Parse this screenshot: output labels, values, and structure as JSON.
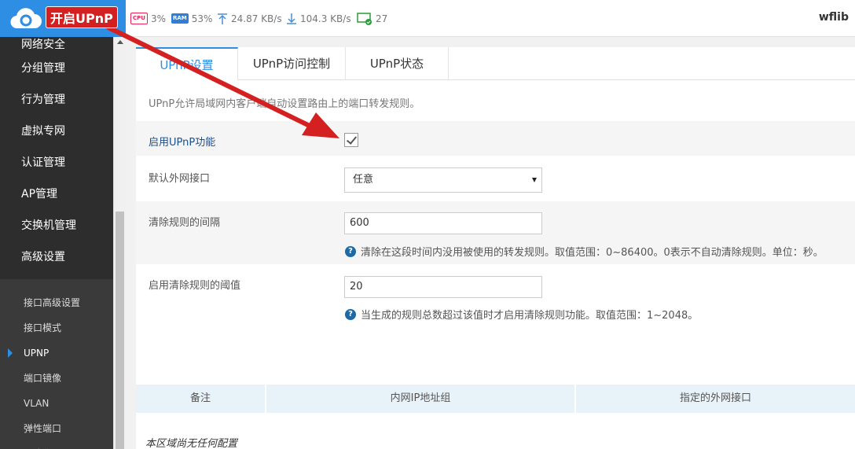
{
  "header": {
    "brand_text": "",
    "cpu_chip": "CPU",
    "cpu_value": "3%",
    "ram_chip": "RAM",
    "ram_value": "53%",
    "upload_value": "24.87 KB/s",
    "download_value": "104.3 KB/s",
    "online_count": "27",
    "username": "wflib",
    "accent_color": "#2d8ee3"
  },
  "sidebar": {
    "main_items": [
      "网络安全",
      "分组管理",
      "行为管理",
      "虚拟专网",
      "认证管理",
      "AP管理",
      "交换机管理",
      "高级设置"
    ],
    "sub_items": [
      "接口高级设置",
      "接口模式",
      "UPNP",
      "端口镜像",
      "VLAN",
      "弹性端口",
      "网络唤醒"
    ],
    "active_sub": "UPNP"
  },
  "tabs": [
    "UPnP设置",
    "UPnP访问控制",
    "UPnP状态"
  ],
  "description": "UPnP允许局域网内客户端自动设置路由上的端口转发规则。",
  "form": {
    "enable_label": "启用UPnP功能",
    "enable_checked": true,
    "wan_label": "默认外网接口",
    "wan_value": "任意",
    "clear_interval_label": "清除规则的间隔",
    "clear_interval_value": "600",
    "clear_interval_hint": "清除在这段时间内没用被使用的转发规则。取值范围：0~86400。0表示不自动清除规则。单位：秒。",
    "threshold_label": "启用清除规则的阈值",
    "threshold_value": "20",
    "threshold_hint": "当生成的规则总数超过该值时才启用清除规则功能。取值范围：1~2048。"
  },
  "table": {
    "headers": [
      "备注",
      "内网IP地址组",
      "指定的外网接口"
    ],
    "empty_text": "本区域尚无任何配置"
  },
  "annotation": {
    "label": "开启UPnP",
    "color": "#d42020"
  }
}
